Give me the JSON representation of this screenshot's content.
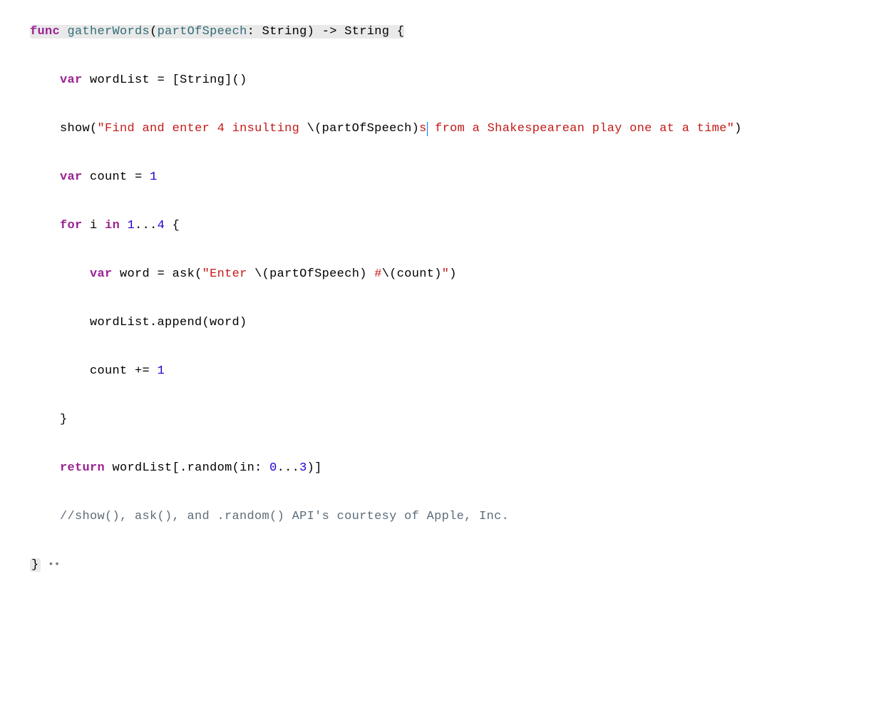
{
  "code": {
    "l1": {
      "func": "func",
      "name": "gatherWords",
      "op": "(",
      "param": "partOfSpeech",
      "colon": ":",
      "ptype": "String",
      "cp": ")",
      "arrow": "->",
      "rtype": "String",
      "ob": "{"
    },
    "l2": {
      "var": "var",
      "name": "wordList",
      "eq": "=",
      "bo": "[",
      "atype": "String",
      "bc": "]()"
    },
    "l3": {
      "show": "show",
      "op": "(",
      "s1": "\"Find and enter 4 insulting ",
      "iopen": "\\(",
      "iexpr": "partOfSpeech",
      "iclose": ")",
      "s2a": "s",
      "s2b": " from a Shakespearean play one at a time\"",
      "cp": ")"
    },
    "l4": {
      "var": "var",
      "name": "count",
      "eq": "=",
      "val": "1"
    },
    "l5": {
      "for": "for",
      "i": "i",
      "in": "in",
      "r1": "1",
      "dots": "...",
      "r2": "4",
      "ob": "{"
    },
    "l6": {
      "var": "var",
      "name": "word",
      "eq": "=",
      "ask": "ask",
      "op": "(",
      "s1": "\"Enter ",
      "io1": "\\(",
      "ie1": "partOfSpeech",
      "ic1": ")",
      "s2": " #",
      "io2": "\\(",
      "ie2": "count",
      "ic2": ")",
      "s3": "\"",
      "cp": ")"
    },
    "l7": {
      "expr": "wordList.append(word)"
    },
    "l8": {
      "name": "count",
      "op": "+=",
      "val": "1"
    },
    "l9": {
      "cb": "}"
    },
    "l10": {
      "ret": "return",
      "wl": "wordList",
      "bo": "[",
      "rand": ".random(in:",
      "r1": "0",
      "dots": "...",
      "r2": "3",
      "bc": ")]"
    },
    "l11": {
      "comment": "//show(), ask(), and .random() API's courtesy of Apple, Inc."
    },
    "l12": {
      "cb": "}",
      "dots": " ••"
    }
  }
}
